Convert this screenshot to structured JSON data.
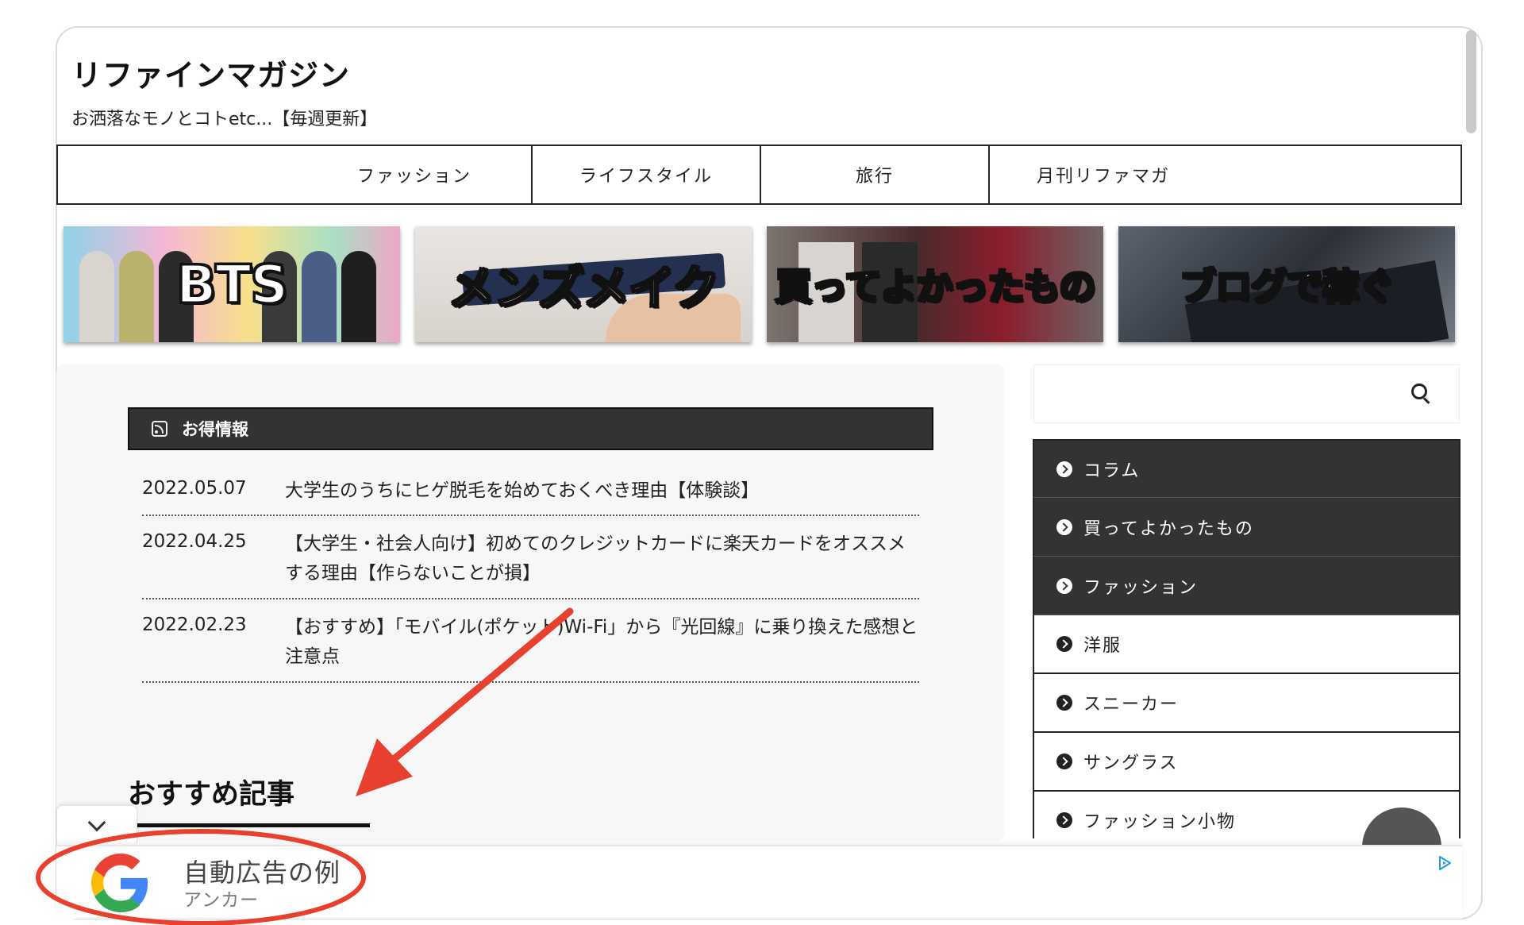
{
  "site": {
    "title": "リファインマガジン",
    "tagline": "お洒落なモノとコトetc...【毎週更新】"
  },
  "nav": {
    "items": [
      "ファッション",
      "ライフスタイル",
      "旅行",
      "月刊リファマガ"
    ]
  },
  "banners": [
    "BTS",
    "メンズメイク",
    "買ってよかったもの",
    "ブログで稼ぐ"
  ],
  "deals": {
    "title": "お得情報",
    "icon": "rss-icon",
    "items": [
      {
        "date": "2022.05.07",
        "title": "大学生のうちにヒゲ脱毛を始めておくべき理由【体験談】"
      },
      {
        "date": "2022.04.25",
        "title": "【大学生・社会人向け】初めてのクレジットカードに楽天カードをオススメする理由【作らないことが損】"
      },
      {
        "date": "2022.02.23",
        "title": "【おすすめ】「モバイル(ポケット)Wi-Fi」から『光回線』に乗り換えた感想と注意点"
      }
    ]
  },
  "recommended": {
    "title": "おすすめ記事"
  },
  "sidebar": {
    "search_icon": "search-icon",
    "categories": [
      {
        "label": "コラム",
        "style": "dark"
      },
      {
        "label": "買ってよかったもの",
        "style": "dark"
      },
      {
        "label": "ファッション",
        "style": "dark"
      },
      {
        "label": "洋服",
        "style": "light"
      },
      {
        "label": "スニーカー",
        "style": "light"
      },
      {
        "label": "サングラス",
        "style": "light"
      },
      {
        "label": "ファッション小物",
        "style": "light"
      }
    ]
  },
  "ad": {
    "title": "自動広告の例",
    "subtitle": "アンカー",
    "logo": "google-logo",
    "choices_icon": "adchoices-icon"
  },
  "annotation": {
    "color": "#e8402f"
  },
  "colors": {
    "dark_bar": "#333333",
    "panel": "#f7f7f7"
  }
}
